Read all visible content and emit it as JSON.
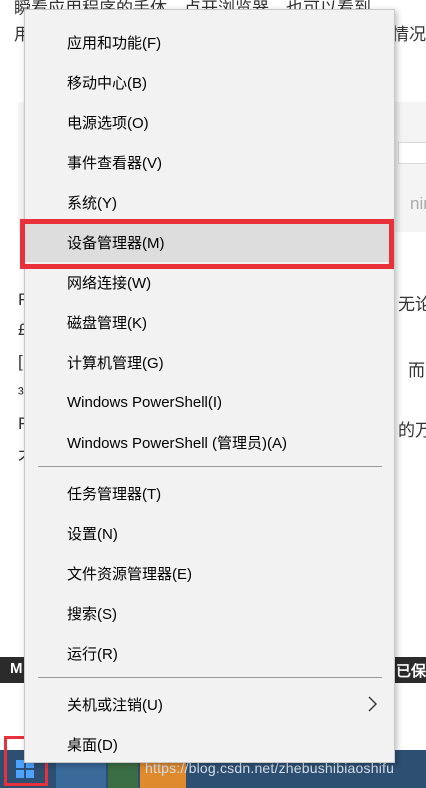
{
  "background": {
    "line1": "瞬看应用程序的手体。点开浏览器，也可以看到",
    "line2": "用",
    "line2_right": "情况",
    "right_frag1": "无论",
    "right_frag2": "而",
    "right_frag3": "的万",
    "left_frag1": "R",
    "left_frag2": "£",
    "left_frag3": "[",
    "left_frag4": "³",
    "left_frag5": "R",
    "left_frag6": "不",
    "screenshot_text": "nim",
    "dark_strip_left": "M",
    "dark_strip_right": "已保"
  },
  "menu": {
    "items": [
      {
        "label": "应用和功能(F)"
      },
      {
        "label": "移动中心(B)"
      },
      {
        "label": "电源选项(O)"
      },
      {
        "label": "事件查看器(V)"
      },
      {
        "label": "系统(Y)"
      },
      {
        "label": "设备管理器(M)"
      },
      {
        "label": "网络连接(W)"
      },
      {
        "label": "磁盘管理(K)"
      },
      {
        "label": "计算机管理(G)"
      },
      {
        "label": "Windows PowerShell(I)"
      },
      {
        "label": "Windows PowerShell (管理员)(A)"
      }
    ],
    "items2": [
      {
        "label": "任务管理器(T)"
      },
      {
        "label": "设置(N)"
      },
      {
        "label": "文件资源管理器(E)"
      },
      {
        "label": "搜索(S)"
      },
      {
        "label": "运行(R)"
      }
    ],
    "items3": [
      {
        "label": "关机或注销(U)",
        "submenu_icon": "chevron-right-icon"
      },
      {
        "label": "桌面(D)"
      }
    ]
  },
  "taskbar": {
    "start_icon": "windows-logo-icon",
    "watermark": "https://blog.csdn.net/zhebushibiaoshifu"
  },
  "colors": {
    "highlight_red": "#e8313b",
    "menu_bg": "#f2f2f2",
    "taskbar_bg": "#2d4f72"
  }
}
